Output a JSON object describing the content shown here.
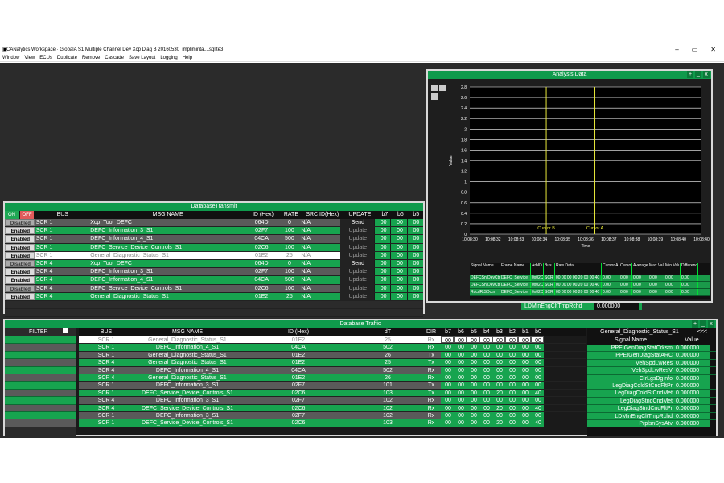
{
  "app": {
    "title": "CANalytics Workspace  ·  GlobalA  S1  Multiple Channel  Dev  Xcp  Diag  B 20160530_impliminta....sqlite3",
    "menu": [
      "Window",
      "View",
      "ECUs",
      "Duplicate",
      "Remove",
      "Cascade",
      "Save Layout",
      "Logging",
      "Help"
    ],
    "window_buttons": [
      "–",
      "▭",
      "✕"
    ]
  },
  "transmit": {
    "title": "DatabaseTransmit",
    "on_label": "ON",
    "off_label": "OFF",
    "headers": [
      "BUS",
      "MSG NAME",
      "ID (Hex)",
      "RATE",
      "SRC ID(Hex)",
      "UPDATE",
      "b7",
      "b6",
      "b5"
    ],
    "rows": [
      {
        "state": "Disabled",
        "bus": "SCR 1",
        "name": "Xcp_Tool_DEFC",
        "id": "064D",
        "rate": "0",
        "src": "N/A",
        "action": "Send",
        "b7": "00",
        "b6": "00",
        "b5": "00",
        "style": "dg"
      },
      {
        "state": "Enabled",
        "bus": "SCR 1",
        "name": "DEFC_Information_3_S1",
        "id": "02F7",
        "rate": "100",
        "src": "N/A",
        "action": "Update",
        "b7": "00",
        "b6": "00",
        "b5": "00",
        "style": "g"
      },
      {
        "state": "Enabled",
        "bus": "SCR 1",
        "name": "DEFC_Information_4_S1",
        "id": "04CA",
        "rate": "500",
        "src": "N/A",
        "action": "Update",
        "b7": "00",
        "b6": "00",
        "b5": "00",
        "style": "dg"
      },
      {
        "state": "Enabled",
        "bus": "SCR 1",
        "name": "DEFC_Service_Device_Controls_S1",
        "id": "02C6",
        "rate": "100",
        "src": "N/A",
        "action": "Update",
        "b7": "00",
        "b6": "00",
        "b5": "00",
        "style": "g"
      },
      {
        "state": "Enabled",
        "bus": "SCR 1",
        "name": "General_Diagnostic_Status_S1",
        "id": "01E2",
        "rate": "25",
        "src": "N/A",
        "action": "Update",
        "b7": "00",
        "b6": "00",
        "b5": "00",
        "style": "wh"
      },
      {
        "state": "Disabled",
        "bus": "SCR 4",
        "name": "Xcp_Tool_DEFC",
        "id": "064D",
        "rate": "0",
        "src": "N/A",
        "action": "Send",
        "b7": "00",
        "b6": "00",
        "b5": "00",
        "style": "g"
      },
      {
        "state": "Enabled",
        "bus": "SCR 4",
        "name": "DEFC_Information_3_S1",
        "id": "02F7",
        "rate": "100",
        "src": "N/A",
        "action": "Update",
        "b7": "00",
        "b6": "00",
        "b5": "00",
        "style": "dg"
      },
      {
        "state": "Enabled",
        "bus": "SCR 4",
        "name": "DEFC_Information_4_S1",
        "id": "04CA",
        "rate": "500",
        "src": "N/A",
        "action": "Update",
        "b7": "00",
        "b6": "00",
        "b5": "00",
        "style": "g"
      },
      {
        "state": "Disabled",
        "bus": "SCR 4",
        "name": "DEFC_Service_Device_Controls_S1",
        "id": "02C6",
        "rate": "100",
        "src": "N/A",
        "action": "Update",
        "b7": "00",
        "b6": "00",
        "b5": "00",
        "style": "dg"
      },
      {
        "state": "Enabled",
        "bus": "SCR 4",
        "name": "General_Diagnostic_Status_S1",
        "id": "01E2",
        "rate": "25",
        "src": "N/A",
        "action": "Update",
        "b7": "00",
        "b6": "00",
        "b5": "00",
        "style": "g"
      }
    ]
  },
  "analysis": {
    "title": "Analysis Data",
    "cursor_a": "Cursor A",
    "cursor_b": "Cursor B",
    "xlabel": "Time",
    "ylabel": "Value",
    "sig_headers": [
      "Signal Name",
      "Frame Name",
      "ArbID",
      "Bus",
      "Raw Data",
      "Cursor A Value",
      "Cursor B Value",
      "Average",
      "Max Value",
      "Min Value",
      "Difference"
    ],
    "sig_rows": [
      [
        "DEFCSrvDevCtrl",
        "DEFC_Service",
        "0x02C6",
        "SCR 1",
        "00 00 00 00 20 00 00 40",
        "0.00",
        "0.00",
        "0.00",
        "0.00",
        "0.00",
        "0.00"
      ],
      [
        "DEFCSrvDevCtrl",
        "DEFC_Service",
        "0x02C6",
        "SCR 1",
        "00 00 00 00 20 00 00 40",
        "0.00",
        "0.00",
        "0.00",
        "0.00",
        "0.00",
        "0.00"
      ],
      [
        "RdcdRtSDctn",
        "DEFC_Service",
        "0x02C6",
        "SCR 1",
        "00 00 00 00 20 00 00 40",
        "0.00",
        "0.00",
        "0.00",
        "0.00",
        "0.00",
        "0.00"
      ]
    ],
    "strip_label": "LDMinEngCltTmpRchd",
    "strip_value": "0.000000"
  },
  "traffic": {
    "title": "Database Traffic",
    "filter_label": "FILTER",
    "headers": [
      "BUS",
      "MSG NAME",
      "ID (Hex)",
      "dT",
      "DIR",
      "b7",
      "b6",
      "b5",
      "b4",
      "b3",
      "b2",
      "b1",
      "b0"
    ],
    "rows": [
      {
        "bus": "SCR 1",
        "name": "General_Diagnostic_Status_S1",
        "id": "01E2",
        "dt": "25",
        "dir": "Rx",
        "bytes": [
          "00",
          "00",
          "00",
          "00",
          "00",
          "00",
          "00",
          "00"
        ],
        "style": "wh"
      },
      {
        "bus": "SCR 1",
        "name": "DEFC_Information_4_S1",
        "id": "04CA",
        "dt": "502",
        "dir": "Rx",
        "bytes": [
          "00",
          "00",
          "00",
          "00",
          "00",
          "00",
          "00",
          "00"
        ],
        "style": "g"
      },
      {
        "bus": "SCR 1",
        "name": "General_Diagnostic_Status_S1",
        "id": "01E2",
        "dt": "26",
        "dir": "Tx",
        "bytes": [
          "00",
          "00",
          "00",
          "00",
          "00",
          "00",
          "00",
          "00"
        ],
        "style": "dg"
      },
      {
        "bus": "SCR 4",
        "name": "General_Diagnostic_Status_S1",
        "id": "01E2",
        "dt": "25",
        "dir": "Tx",
        "bytes": [
          "00",
          "00",
          "00",
          "00",
          "00",
          "00",
          "00",
          "00"
        ],
        "style": "g"
      },
      {
        "bus": "SCR 4",
        "name": "DEFC_Information_4_S1",
        "id": "04CA",
        "dt": "502",
        "dir": "Rx",
        "bytes": [
          "00",
          "00",
          "00",
          "00",
          "00",
          "00",
          "00",
          "00"
        ],
        "style": "dg"
      },
      {
        "bus": "SCR 4",
        "name": "General_Diagnostic_Status_S1",
        "id": "01E2",
        "dt": "26",
        "dir": "Rx",
        "bytes": [
          "00",
          "00",
          "00",
          "00",
          "00",
          "00",
          "00",
          "00"
        ],
        "style": "g"
      },
      {
        "bus": "SCR 1",
        "name": "DEFC_Information_3_S1",
        "id": "02F7",
        "dt": "101",
        "dir": "Tx",
        "bytes": [
          "00",
          "00",
          "00",
          "00",
          "00",
          "00",
          "00",
          "00"
        ],
        "style": "dg"
      },
      {
        "bus": "SCR 1",
        "name": "DEFC_Service_Device_Controls_S1",
        "id": "02C6",
        "dt": "103",
        "dir": "Tx",
        "bytes": [
          "00",
          "00",
          "00",
          "00",
          "20",
          "00",
          "00",
          "40"
        ],
        "style": "g"
      },
      {
        "bus": "SCR 4",
        "name": "DEFC_Information_3_S1",
        "id": "02F7",
        "dt": "102",
        "dir": "Rx",
        "bytes": [
          "00",
          "00",
          "00",
          "00",
          "00",
          "00",
          "00",
          "00"
        ],
        "style": "dg"
      },
      {
        "bus": "SCR 4",
        "name": "DEFC_Service_Device_Controls_S1",
        "id": "02C6",
        "dt": "102",
        "dir": "Rx",
        "bytes": [
          "00",
          "00",
          "00",
          "00",
          "20",
          "00",
          "00",
          "40"
        ],
        "style": "g"
      },
      {
        "bus": "SCR 1",
        "name": "DEFC_Information_3_S1",
        "id": "02F7",
        "dt": "102",
        "dir": "Rx",
        "bytes": [
          "00",
          "00",
          "00",
          "00",
          "00",
          "00",
          "00",
          "00"
        ],
        "style": "dg"
      },
      {
        "bus": "SCR 1",
        "name": "DEFC_Service_Device_Controls_S1",
        "id": "02C6",
        "dt": "103",
        "dir": "Rx",
        "bytes": [
          "00",
          "00",
          "00",
          "00",
          "20",
          "00",
          "00",
          "40"
        ],
        "style": "g"
      }
    ],
    "signal_panel": {
      "title": "General_Diagnostic_Status_S1",
      "collapse": "<<<",
      "col_name": "Signal Name",
      "col_value": "Value",
      "signals": [
        {
          "name": "PPEIGenDiagStatCrksm",
          "value": "0.000000"
        },
        {
          "name": "PPEIGenDiagStatARC",
          "value": "0.000000"
        },
        {
          "name": "VehSpdLwRes",
          "value": "0.000000"
        },
        {
          "name": "VehSpdLwResV",
          "value": "0.000000"
        },
        {
          "name": "CIrLgsDgInfo",
          "value": "0.000000"
        },
        {
          "name": "LegDiagColdStCndFltPr",
          "value": "0.000000"
        },
        {
          "name": "LegDiagColdStCndMet",
          "value": "0.000000"
        },
        {
          "name": "LegDiagStndCndMet",
          "value": "0.000000"
        },
        {
          "name": "LegDiagStndCndFltPr",
          "value": "0.000000"
        },
        {
          "name": "LDMinEngCltTmpRchd",
          "value": "0.000000"
        },
        {
          "name": "PrplsnSysAtv",
          "value": "0.000000"
        }
      ]
    }
  },
  "chart_data": {
    "type": "line",
    "title": "",
    "xlabel": "Time",
    "ylabel": "Value",
    "ylim": [
      0,
      2.8
    ],
    "yticks": [
      "0",
      "0.2",
      "0.4",
      "0.6",
      "0.8",
      "1",
      "1.2",
      "1.4",
      "1.6",
      "1.8",
      "2",
      "2.2",
      "2.4",
      "2.6",
      "2.8"
    ],
    "xticks": [
      "10:08:30",
      "10:08:32",
      "10:08:33",
      "10:08:34",
      "10:08:35",
      "10:08:36",
      "10:08:37",
      "10:08:38",
      "10:08:39",
      "10:08:40",
      "10:08:40"
    ],
    "cursors": [
      {
        "name": "Cursor B",
        "x_index": 3.3
      },
      {
        "name": "Cursor A",
        "x_index": 5.4
      }
    ],
    "series": []
  }
}
